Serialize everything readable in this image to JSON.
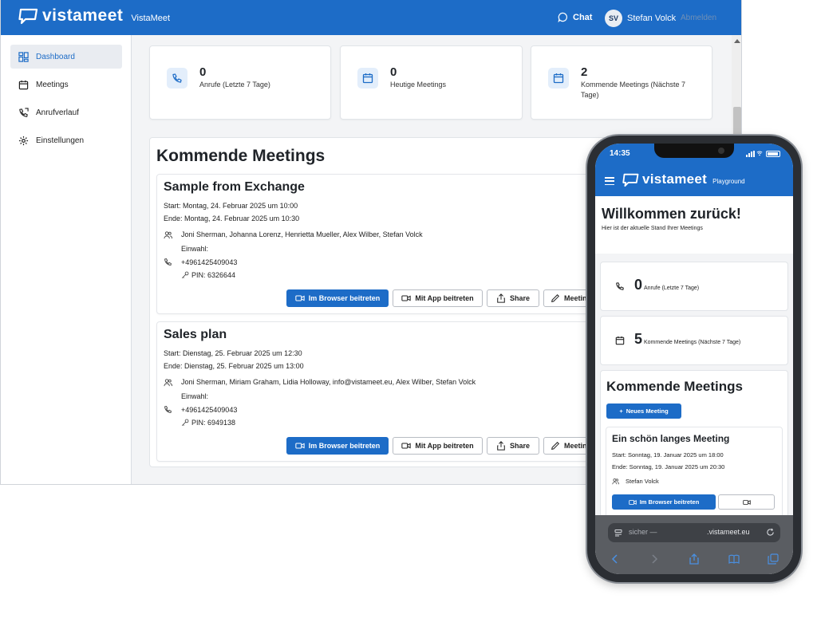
{
  "desktop": {
    "header": {
      "logo_word": "vistameet",
      "app_name": "VistaMeet",
      "chat_label": "Chat",
      "user_initials": "SV",
      "user_name": "Stefan Volck",
      "logout_label": "Abmelden"
    },
    "sidebar": {
      "items": [
        {
          "label": "Dashboard",
          "icon": "dashboard-icon",
          "active": true
        },
        {
          "label": "Meetings",
          "icon": "calendar-icon",
          "active": false
        },
        {
          "label": "Anrufverlauf",
          "icon": "phone-history-icon",
          "active": false
        },
        {
          "label": "Einstellungen",
          "icon": "gear-icon",
          "active": false
        }
      ]
    },
    "stats": [
      {
        "value": "0",
        "label": "Anrufe (Letzte 7 Tage)",
        "icon": "phone-icon"
      },
      {
        "value": "0",
        "label": "Heutige Meetings",
        "icon": "calendar-icon"
      },
      {
        "value": "2",
        "label": "Kommende Meetings (Nächste 7 Tage)",
        "icon": "calendar-icon"
      }
    ],
    "upcoming": {
      "title": "Kommende Meetings",
      "meetings": [
        {
          "title": "Sample from Exchange",
          "start": "Start: Montag, 24. Februar 2025 um 10:00",
          "end": "Ende: Montag, 24. Februar 2025 um 10:30",
          "participants": "Joni Sherman, Johanna Lorenz, Henrietta Mueller, Alex Wilber, Stefan Volck",
          "dialin_label": "Einwahl:",
          "phone": "+4961425409043",
          "pin": "PIN: 6326644"
        },
        {
          "title": "Sales plan",
          "start": "Start: Dienstag, 25. Februar 2025 um 12:30",
          "end": "Ende: Dienstag, 25. Februar 2025 um 13:00",
          "participants": "Joni Sherman, Miriam Graham, Lidia Holloway, info@vistameet.eu, Alex Wilber, Stefan Volck",
          "dialin_label": "Einwahl:",
          "phone": "+4961425409043",
          "pin": "PIN: 6949138"
        }
      ],
      "buttons": {
        "browser": "Im Browser beitreten",
        "app": "Mit App beitreten",
        "share": "Share",
        "edit": "Meeting bearbeiten"
      }
    }
  },
  "phone": {
    "status_time": "14:35",
    "header": {
      "logo_word": "vistameet",
      "app_name": "Playground"
    },
    "welcome_title": "Willkommen zurück!",
    "welcome_subtitle": "Hier ist der aktuelle Stand Ihrer Meetings",
    "stats": [
      {
        "value": "0",
        "label": "Anrufe (Letzte 7 Tage)",
        "icon": "phone-icon"
      },
      {
        "value": "5",
        "label": "Kommende Meetings (Nächste 7 Tage)",
        "icon": "calendar-icon"
      }
    ],
    "upcoming_title": "Kommende Meetings",
    "new_meeting_label": "Neues Meeting",
    "meeting": {
      "title": "Ein schön langes Meeting",
      "start": "Start: Sonntag, 19. Januar 2025 um 18:00",
      "end": "Ende: Sonntag, 19. Januar 2025 um 20:30",
      "participants": "Stefan Volck",
      "browser_label": "Im Browser beitreten"
    },
    "browser": {
      "url_prefix": "sicher —",
      "url_domain": ".vistameet.eu"
    }
  },
  "colors": {
    "brand": "#1d6cc7",
    "background": "#f3f4f6"
  }
}
